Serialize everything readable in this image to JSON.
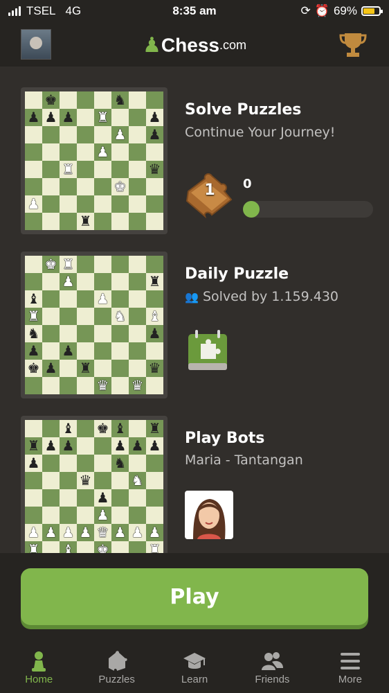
{
  "status": {
    "carrier": "TSEL",
    "network": "4G",
    "time": "8:35 am",
    "battery": "69%"
  },
  "header": {
    "logo_text": "Chess",
    "logo_domain": ".com"
  },
  "cards": [
    {
      "title": "Solve Puzzles",
      "subtitle": "Continue Your Journey!",
      "badge_number": "1",
      "progress_value": "0",
      "progress_fraction": 0.04
    },
    {
      "title": "Daily Puzzle",
      "subtitle": "Solved by 1.159.430"
    },
    {
      "title": "Play Bots",
      "subtitle": "Maria - Tantangan"
    }
  ],
  "boards": [
    [
      "",
      "bk",
      "",
      "",
      "",
      "bn",
      "",
      "",
      "bp",
      "bp",
      "bp",
      "",
      "wr",
      "",
      "",
      "bp",
      "",
      "",
      "",
      "",
      "",
      "wp",
      "",
      "bp",
      "",
      "",
      "",
      "",
      "wp",
      "",
      "",
      "",
      "",
      "",
      "wr",
      "",
      "",
      "",
      "",
      "bq",
      "",
      "",
      "",
      "",
      "",
      "wk",
      "",
      "",
      "wp",
      "",
      "",
      "",
      "",
      "",
      "",
      "",
      "",
      "",
      "",
      "br",
      "",
      "",
      "",
      ""
    ],
    [
      "",
      "wk",
      "wr",
      "",
      "",
      "",
      "",
      "",
      "",
      "",
      "wp",
      "",
      "",
      "",
      "",
      "br",
      "bb",
      "",
      "",
      "",
      "wp",
      "",
      "",
      "",
      "wr",
      "",
      "",
      "",
      "",
      "wn",
      "",
      "wb",
      "bn",
      "",
      "",
      "",
      "",
      "",
      "",
      "bp",
      "bp",
      "",
      "bp",
      "",
      "",
      "",
      "",
      "",
      "bk",
      "bp",
      "",
      "br",
      "",
      "",
      "",
      "bq",
      "",
      "",
      "",
      "",
      "wq",
      "",
      "wq",
      ""
    ],
    [
      "",
      "",
      "bb",
      "",
      "bk",
      "bb",
      "",
      "br",
      "br",
      "bp",
      "bp",
      "",
      "",
      "bp",
      "bp",
      "bp",
      "bp",
      "",
      "",
      "",
      "",
      "bn",
      "",
      "",
      "",
      "",
      "",
      "bq",
      "",
      "",
      "wn",
      "",
      "",
      "",
      "",
      "",
      "bp",
      "",
      "",
      "",
      "",
      "",
      "",
      "",
      "wp",
      "",
      "",
      "",
      "wp",
      "wp",
      "wp",
      "wp",
      "wq",
      "wp",
      "wp",
      "wp",
      "wr",
      "",
      "wb",
      "",
      "wk",
      "",
      "",
      "wr"
    ]
  ],
  "play_button": {
    "label": "Play"
  },
  "nav": [
    {
      "label": "Home",
      "icon": "pawn-icon"
    },
    {
      "label": "Puzzles",
      "icon": "puzzle-icon"
    },
    {
      "label": "Learn",
      "icon": "graduation-cap-icon"
    },
    {
      "label": "Friends",
      "icon": "friends-icon"
    },
    {
      "label": "More",
      "icon": "menu-icon"
    }
  ],
  "colors": {
    "accent": "#81b64c",
    "bg": "#312e2b",
    "bar": "#262421",
    "board_light": "#eeeed2",
    "board_dark": "#769656"
  }
}
